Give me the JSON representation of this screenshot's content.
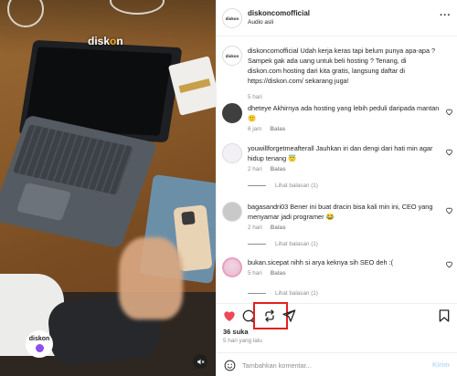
{
  "media": {
    "watermark_prefix": "disk",
    "watermark_o": "o",
    "watermark_suffix": "n",
    "badge_text": "diskon"
  },
  "header": {
    "username": "diskoncomofficial",
    "audio": "Audio asli"
  },
  "caption": {
    "username": "diskoncomofficial",
    "text": "Udah kerja keras tapi belum punya apa-apa ? Sampek gak ada uang untuk beli hosting ? Tenang, di diskon.com hosting dari kita gratis, langsung daftar di https://diskon.com/ sekarang juga!",
    "time": "5 hari"
  },
  "comments": [
    {
      "username": "dheteye",
      "text": "Akhirnya ada hosting yang lebih peduli daripada mantan 🙂",
      "time": "6 jam",
      "reply_label": "Balas"
    },
    {
      "username": "youwillforgetmeafterall",
      "text": "Jauhkan iri dan dengi dari hati min agar hidup tenang 😇",
      "time": "2 hari",
      "reply_label": "Balas",
      "view_replies": "Lihat balasan (1)"
    },
    {
      "username": "bagasandri03",
      "text": "Bener ini buat dracin bisa kali min ini, CEO yang menyamar jadi programer 😂",
      "time": "2 hari",
      "reply_label": "Balas",
      "view_replies": "Lihat balasan (1)"
    },
    {
      "username": "bukan.sicepat",
      "text": "nihh si arya keknya sih SEO deh :(",
      "time": "5 hari",
      "reply_label": "Balas",
      "view_replies": "Lihat balasan (1)"
    }
  ],
  "post": {
    "likes": "36 suka",
    "posted": "5 hari yang lalu"
  },
  "add_comment": {
    "placeholder": "Tambahkan komentar...",
    "send_label": "Kirim"
  },
  "colors": {
    "like_red": "#ed4956",
    "highlight_red": "#e3201f",
    "send_disabled": "#b3dbff",
    "muted_text": "#8e8e8e"
  },
  "icons": {
    "more": "more-horizontal-icon",
    "like": "heart-filled-icon",
    "comment": "comment-bubble-icon",
    "repost": "repost-icon",
    "share": "send-paper-plane-icon",
    "save": "bookmark-icon",
    "emoji": "smiley-icon",
    "mute": "speaker-muted-icon"
  }
}
